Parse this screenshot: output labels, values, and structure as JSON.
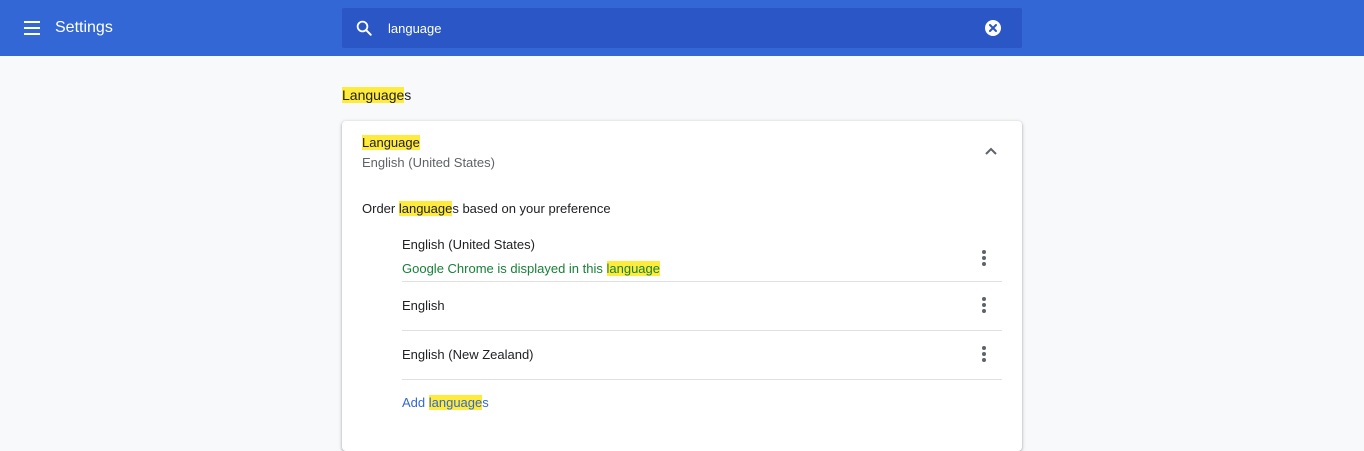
{
  "colors": {
    "toolbar": "#3367d6",
    "search_bg": "#2a56c6",
    "highlight": "#ffeb3b",
    "link": "#3367d6",
    "success": "#188038"
  },
  "toolbar": {
    "title": "Settings",
    "menu_icon": "hamburger-menu-icon"
  },
  "search": {
    "value": "language",
    "search_icon": "search-icon",
    "clear_icon": "clear-circle-icon"
  },
  "section": {
    "heading_match": "Language",
    "heading_rest": "s"
  },
  "card": {
    "title": "Language",
    "current_value": "English (United States)",
    "toggle_icon": "chevron-up-icon",
    "order_label_before": "Order ",
    "order_label_match": "language",
    "order_label_after": "s based on your preference",
    "languages": [
      {
        "name": "English (United States)",
        "note_before": "Google Chrome is displayed in this ",
        "note_match": "language"
      },
      {
        "name": "English"
      },
      {
        "name": "English (New Zealand)"
      }
    ],
    "add_before": "Add ",
    "add_match": "language",
    "add_after": "s"
  }
}
